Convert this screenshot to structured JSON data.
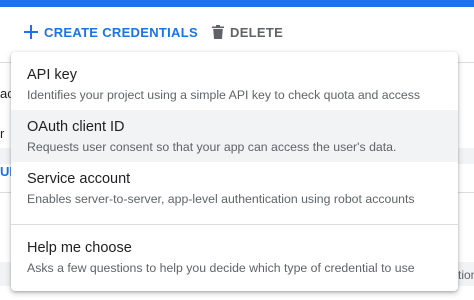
{
  "toolbar": {
    "create_label": "CREATE CREDENTIALS",
    "delete_label": "DELETE"
  },
  "background": {
    "left_fragment_1": "acc",
    "left_fragment_2": "r",
    "left_fragment_3": "UR",
    "right_fragment": "tion"
  },
  "menu": {
    "items": [
      {
        "title": "API key",
        "description": "Identifies your project using a simple API key to check quota and access"
      },
      {
        "title": "OAuth client ID",
        "description": "Requests user consent so that your app can access the user's data."
      },
      {
        "title": "Service account",
        "description": "Enables server-to-server, app-level authentication using robot accounts"
      }
    ],
    "help": {
      "title": "Help me choose",
      "description": "Asks a few questions to help you decide which type of credential to use"
    }
  },
  "colors": {
    "accent": "#1a73e8",
    "highlight": "#f1f3f4",
    "secondary_text": "#5f6368"
  },
  "icons": {
    "create": "plus-icon",
    "delete": "trash-icon"
  }
}
